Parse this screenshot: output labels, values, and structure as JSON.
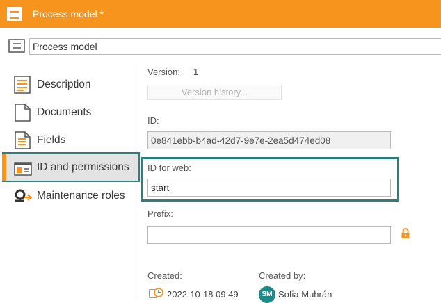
{
  "window": {
    "title": "Process model *"
  },
  "header": {
    "name_value": "Process model"
  },
  "sidebar": {
    "items": [
      {
        "label": "Description",
        "icon": "description-icon"
      },
      {
        "label": "Documents",
        "icon": "document-icon"
      },
      {
        "label": "Fields",
        "icon": "fields-icon"
      },
      {
        "label": "ID and permissions",
        "icon": "id-card-icon",
        "active": true
      },
      {
        "label": "Maintenance roles",
        "icon": "maintenance-roles-icon"
      }
    ]
  },
  "form": {
    "version_label": "Version:",
    "version_value": "1",
    "version_history_button": "Version history...",
    "id_label": "ID:",
    "id_value": "0e841ebb-b4ad-42d7-9e7e-2ea5d474ed08",
    "web_id_label": "ID for web:",
    "web_id_value": "start",
    "prefix_label": "Prefix:",
    "prefix_value": "",
    "created_label": "Created:",
    "created_value": "2022-10-18 09:49",
    "created_by_label": "Created by:",
    "created_by_value": "Sofia Muhrán",
    "created_by_initials": "SM"
  },
  "colors": {
    "accent": "#f7941d",
    "highlight": "#2a7f7f",
    "avatar": "#1e8a8a"
  }
}
